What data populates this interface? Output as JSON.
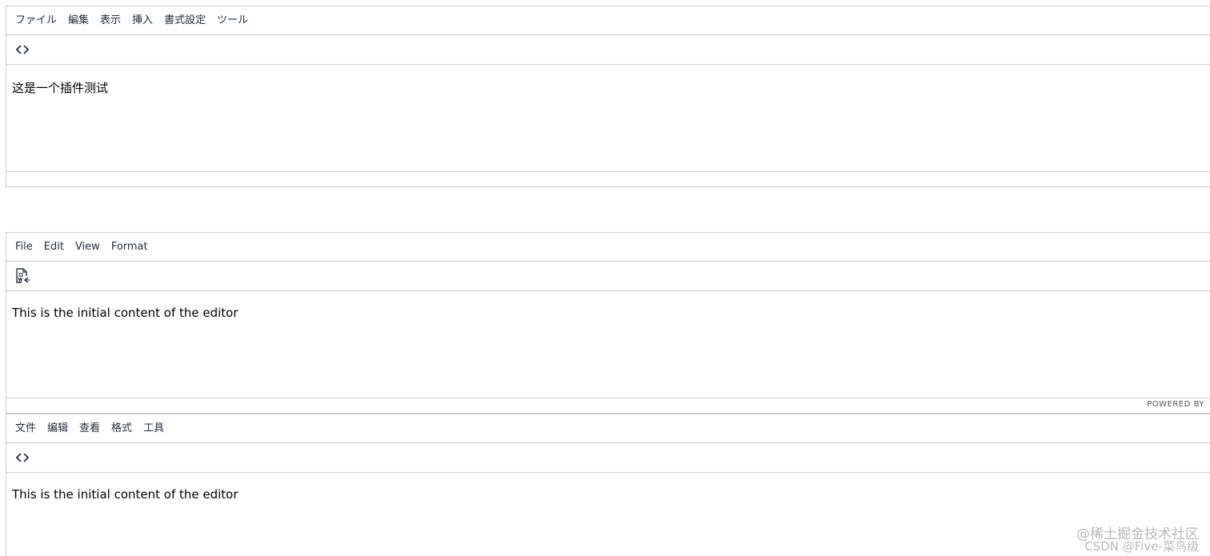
{
  "editors": [
    {
      "menu": [
        "ファイル",
        "編集",
        "表示",
        "挿入",
        "書式設定",
        "ツール"
      ],
      "toolbar_icon": "code-icon",
      "content": "这是一个插件测试",
      "status": ""
    },
    {
      "menu": [
        "File",
        "Edit",
        "View",
        "Format"
      ],
      "toolbar_icon": "word-count-icon",
      "content": "This is the initial content of the editor",
      "status": "POWERED BY"
    },
    {
      "menu": [
        "文件",
        "编辑",
        "查看",
        "格式",
        "工具"
      ],
      "toolbar_icon": "code-icon",
      "content": "This is the initial content of the editor",
      "status": ""
    }
  ],
  "watermark": {
    "line1": "@稀土掘金技术社区",
    "line2": "CSDN @Five-菜鸟级"
  },
  "colors": {
    "border": "#cccccc",
    "menu_text": "#222f3e",
    "watermark": "#b8b8b8"
  }
}
